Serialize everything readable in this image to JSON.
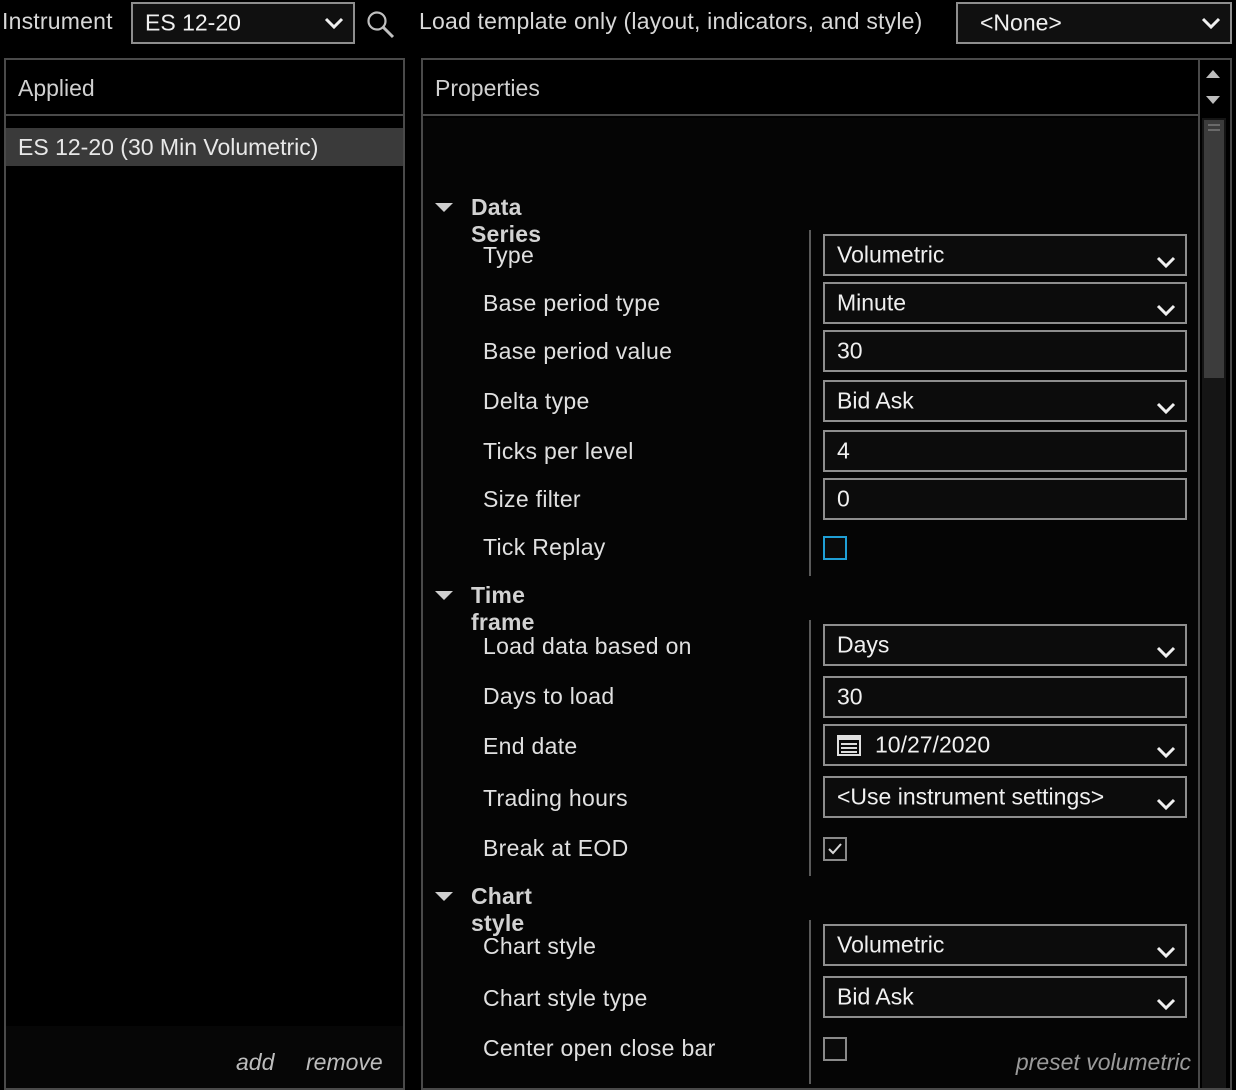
{
  "toolbar": {
    "instrument_label": "Instrument",
    "instrument_value": "ES 12-20",
    "search_icon": "search-icon",
    "template_label": "Load template only (layout, indicators, and style)",
    "template_value": "<None>"
  },
  "applied": {
    "header": "Applied",
    "items": [
      "ES 12-20 (30 Min Volumetric)"
    ],
    "add_label": "add",
    "remove_label": "remove"
  },
  "properties": {
    "header": "Properties",
    "data_series": {
      "title": "Data Series",
      "type_label": "Type",
      "type_value": "Volumetric",
      "base_period_type_label": "Base period type",
      "base_period_type_value": "Minute",
      "base_period_value_label": "Base period value",
      "base_period_value_value": "30",
      "delta_type_label": "Delta type",
      "delta_type_value": "Bid Ask",
      "ticks_per_level_label": "Ticks per level",
      "ticks_per_level_value": "4",
      "size_filter_label": "Size filter",
      "size_filter_value": "0",
      "tick_replay_label": "Tick Replay",
      "tick_replay_checked": false
    },
    "time_frame": {
      "title": "Time frame",
      "load_data_label": "Load data based on",
      "load_data_value": "Days",
      "days_to_load_label": "Days to load",
      "days_to_load_value": "30",
      "end_date_label": "End date",
      "end_date_value": "10/27/2020",
      "trading_hours_label": "Trading hours",
      "trading_hours_value": "<Use instrument settings>",
      "break_eod_label": "Break at EOD",
      "break_eod_checked": true
    },
    "chart_style": {
      "title": "Chart style",
      "chart_style_label": "Chart style",
      "chart_style_value": "Volumetric",
      "chart_style_type_label": "Chart style type",
      "chart_style_type_value": "Bid Ask",
      "center_bar_label": "Center open close bar",
      "center_bar_checked": false
    },
    "preset_label": "preset volumetric"
  },
  "colors": {
    "background": "#000000",
    "border": "#8e8e8e",
    "selected_row": "#3a3a3a",
    "checkbox_focus": "#1f9fd6"
  }
}
